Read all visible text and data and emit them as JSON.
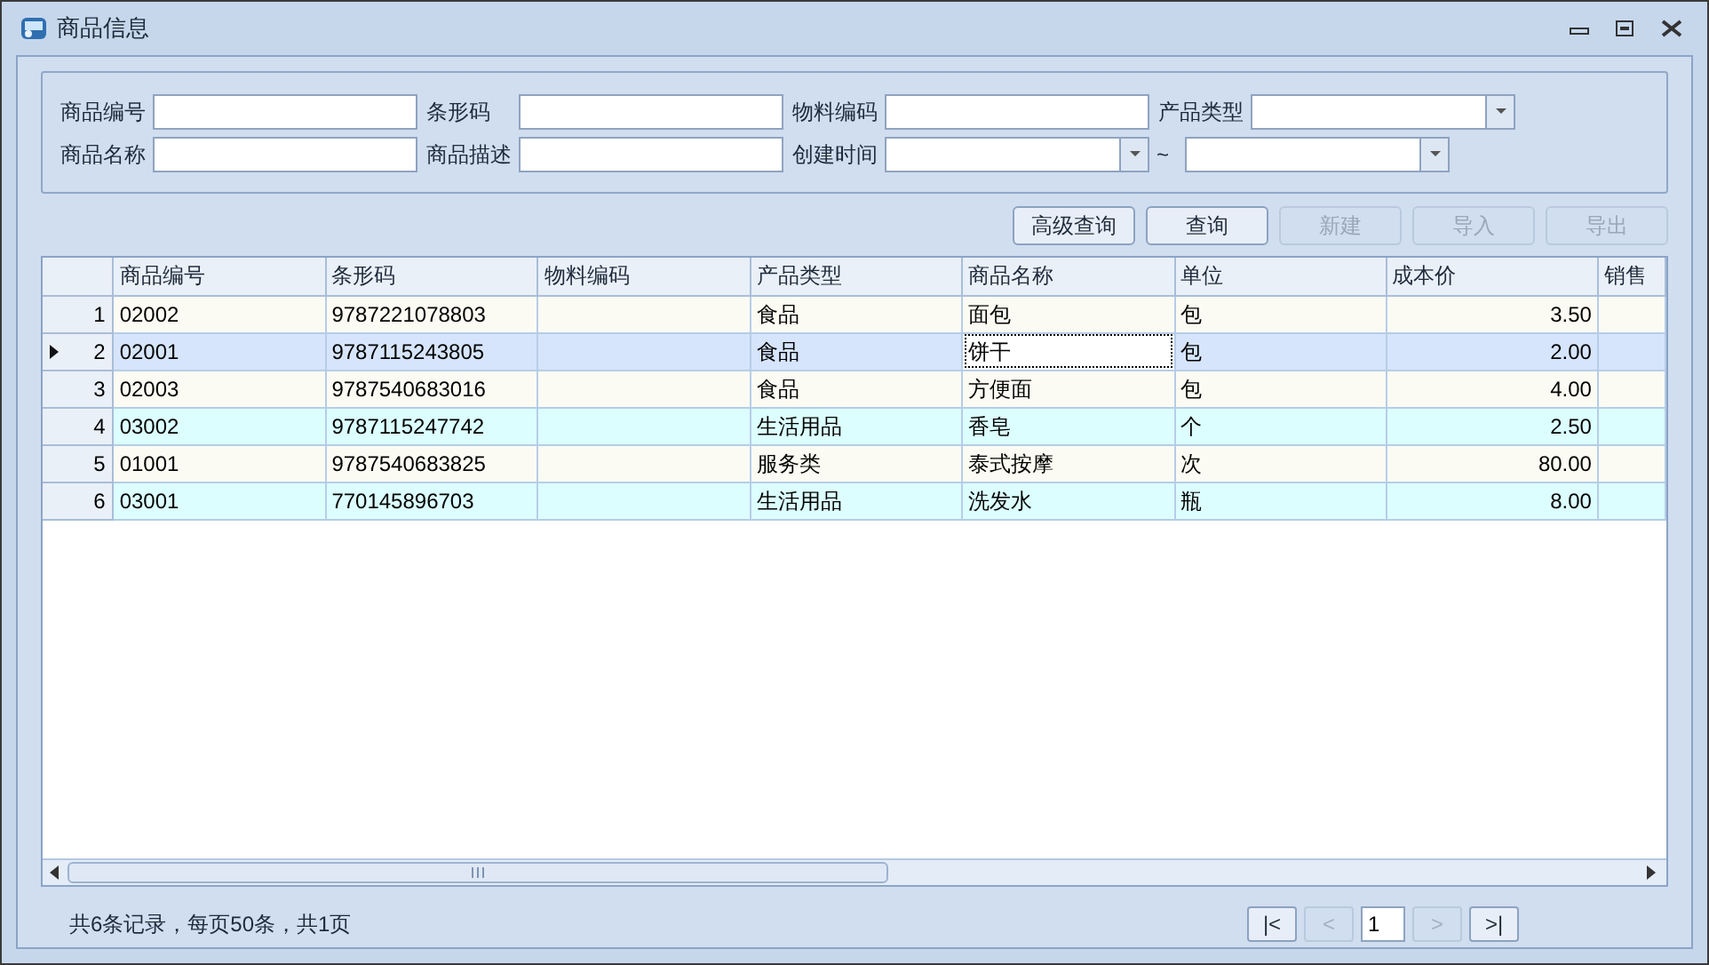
{
  "window": {
    "title": "商品信息"
  },
  "search": {
    "rows": [
      [
        {
          "label": "商品编号",
          "kind": "text"
        },
        {
          "label": "条形码",
          "kind": "text"
        },
        {
          "label": "物料编码",
          "kind": "text"
        },
        {
          "label": "产品类型",
          "kind": "combo"
        }
      ],
      [
        {
          "label": "商品名称",
          "kind": "text"
        },
        {
          "label": "商品描述",
          "kind": "text"
        },
        {
          "label": "创建时间",
          "kind": "date"
        },
        {
          "label": "~",
          "kind": "date"
        }
      ]
    ]
  },
  "toolbar": [
    {
      "label": "高级查询",
      "disabled": false
    },
    {
      "label": "查询",
      "disabled": false
    },
    {
      "label": "新建",
      "disabled": true
    },
    {
      "label": "导入",
      "disabled": true
    },
    {
      "label": "导出",
      "disabled": true
    }
  ],
  "table": {
    "columns": [
      "商品编号",
      "条形码",
      "物料编码",
      "产品类型",
      "商品名称",
      "单位",
      "成本价",
      "销售"
    ],
    "rows": [
      {
        "number": "1",
        "selected": false,
        "cells": [
          "02002",
          "9787221078803",
          "",
          "食品",
          "面包",
          "包",
          "3.50",
          ""
        ]
      },
      {
        "number": "2",
        "selected": true,
        "cells": [
          "02001",
          "9787115243805",
          "",
          "食品",
          "饼干",
          "包",
          "2.00",
          ""
        ]
      },
      {
        "number": "3",
        "selected": false,
        "cells": [
          "02003",
          "9787540683016",
          "",
          "食品",
          "方便面",
          "包",
          "4.00",
          ""
        ]
      },
      {
        "number": "4",
        "selected": false,
        "cells": [
          "03002",
          "9787115247742",
          "",
          "生活用品",
          "香皂",
          "个",
          "2.50",
          ""
        ]
      },
      {
        "number": "5",
        "selected": false,
        "cells": [
          "01001",
          "9787540683825",
          "",
          "服务类",
          "泰式按摩",
          "次",
          "80.00",
          ""
        ]
      },
      {
        "number": "6",
        "selected": false,
        "cells": [
          "03001",
          "770145896703",
          "",
          "生活用品",
          "洗发水",
          "瓶",
          "8.00",
          ""
        ]
      }
    ]
  },
  "status_bar": {
    "summary": "共6条记录，每页50条，共1页",
    "pager": [
      {
        "label": "|<",
        "disabled": false,
        "kind": "button"
      },
      {
        "label": "<",
        "disabled": true,
        "kind": "button"
      },
      {
        "label": "1",
        "kind": "page"
      },
      {
        "label": ">",
        "disabled": true,
        "kind": "button"
      },
      {
        "label": ">|",
        "disabled": false,
        "kind": "button"
      }
    ]
  }
}
